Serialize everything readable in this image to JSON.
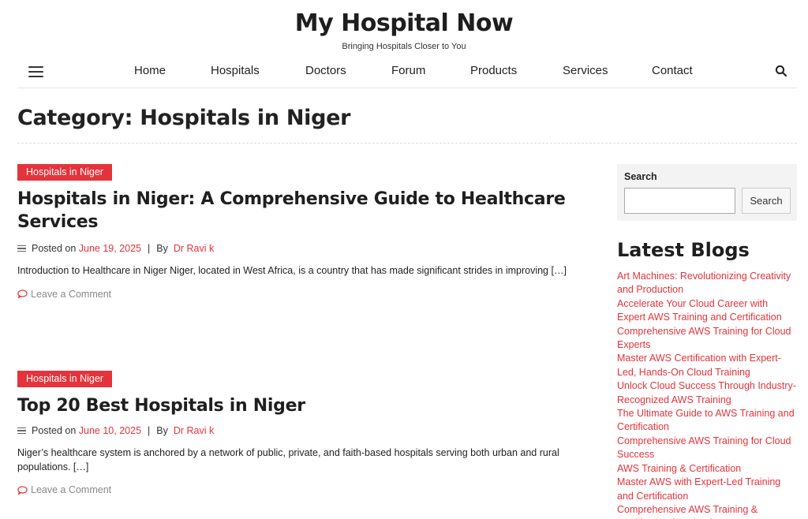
{
  "site": {
    "title": "My Hospital Now",
    "tagline": "Bringing Hospitals Closer to You"
  },
  "nav": {
    "items": [
      "Home",
      "Hospitals",
      "Doctors",
      "Forum",
      "Products",
      "Services",
      "Contact"
    ]
  },
  "archive": {
    "title": "Category: Hospitals in Niger"
  },
  "posts": [
    {
      "category": "Hospitals in Niger",
      "title": "Hospitals in Niger: A Comprehensive Guide to Healthcare Services",
      "posted_on": "Posted on",
      "date": "June 19, 2025",
      "separator": "|",
      "by": "By",
      "author": "Dr Ravi k",
      "excerpt": "Introduction to Healthcare in Niger Niger, located in West Africa, is a country that has made significant strides in improving […]",
      "comment_link": "Leave a Comment"
    },
    {
      "category": "Hospitals in Niger",
      "title": "Top 20 Best Hospitals in Niger",
      "posted_on": "Posted on",
      "date": "June 10, 2025",
      "separator": "|",
      "by": "By",
      "author": "Dr Ravi k",
      "excerpt": "Niger’s healthcare system is anchored by a network of public, private, and faith-based hospitals serving both urban and rural populations. […]",
      "comment_link": "Leave a Comment"
    }
  ],
  "sidebar": {
    "search": {
      "label": "Search",
      "value": "",
      "button": "Search"
    },
    "latest_title": "Latest Blogs",
    "latest_items": [
      "Art Machines: Revolutionizing Creativity and Production",
      "Accelerate Your Cloud Career with Expert AWS Training and Certification",
      "Comprehensive AWS Training for Cloud Experts",
      "Master AWS Certification with Expert-Led, Hands-On Cloud Training",
      "Unlock Cloud Success Through Industry-Recognized AWS Training",
      "The Ultimate Guide to AWS Training and Certification",
      "Comprehensive AWS Training for Cloud Success",
      "AWS Training & Certification",
      "Master AWS with Expert-Led Training and Certification",
      "Comprehensive AWS Training & Certification for Cloud"
    ]
  },
  "icons": {
    "menu": "hamburger-icon",
    "search": "search-icon",
    "meta": "list-icon",
    "comment": "comment-bubble-icon"
  },
  "colors": {
    "accent": "#e5333b",
    "text": "#222222",
    "muted": "#888888"
  }
}
